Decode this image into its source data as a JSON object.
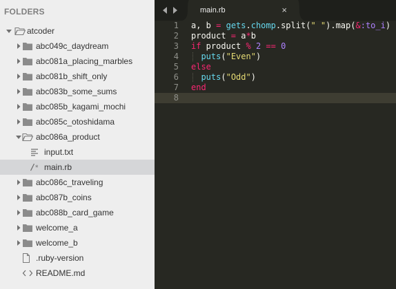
{
  "sidebar": {
    "header": "FOLDERS",
    "tree": [
      {
        "label": "atcoder",
        "type": "folder",
        "state": "open",
        "depth": 0,
        "name": "atcoder"
      },
      {
        "label": "abc049c_daydream",
        "type": "folder",
        "state": "closed",
        "depth": 1,
        "name": "abc049c-daydream"
      },
      {
        "label": "abc081a_placing_marbles",
        "type": "folder",
        "state": "closed",
        "depth": 1,
        "name": "abc081a-placing-marbles"
      },
      {
        "label": "abc081b_shift_only",
        "type": "folder",
        "state": "closed",
        "depth": 1,
        "name": "abc081b-shift-only"
      },
      {
        "label": "abc083b_some_sums",
        "type": "folder",
        "state": "closed",
        "depth": 1,
        "name": "abc083b-some-sums"
      },
      {
        "label": "abc085b_kagami_mochi",
        "type": "folder",
        "state": "closed",
        "depth": 1,
        "name": "abc085b-kagami-mochi"
      },
      {
        "label": "abc085c_otoshidama",
        "type": "folder",
        "state": "closed",
        "depth": 1,
        "name": "abc085c-otoshidama"
      },
      {
        "label": "abc086a_product",
        "type": "folder",
        "state": "open",
        "depth": 1,
        "name": "abc086a-product"
      },
      {
        "label": "input.txt",
        "type": "text-file",
        "depth": 2,
        "name": "input-txt"
      },
      {
        "label": "main.rb",
        "type": "code-file",
        "depth": 2,
        "selected": true,
        "name": "main-rb"
      },
      {
        "label": "abc086c_traveling",
        "type": "folder",
        "state": "closed",
        "depth": 1,
        "name": "abc086c-traveling"
      },
      {
        "label": "abc087b_coins",
        "type": "folder",
        "state": "closed",
        "depth": 1,
        "name": "abc087b-coins"
      },
      {
        "label": "abc088b_card_game",
        "type": "folder",
        "state": "closed",
        "depth": 1,
        "name": "abc088b-card-game"
      },
      {
        "label": "welcome_a",
        "type": "folder",
        "state": "closed",
        "depth": 1,
        "name": "welcome-a"
      },
      {
        "label": "welcome_b",
        "type": "folder",
        "state": "closed",
        "depth": 1,
        "name": "welcome-b"
      },
      {
        "label": ".ruby-version",
        "type": "file",
        "depth": 1,
        "name": "ruby-version"
      },
      {
        "label": "README.md",
        "type": "markup-file",
        "depth": 1,
        "name": "readme-md"
      }
    ]
  },
  "editor": {
    "nav": {
      "back_icon": "triangle-left-icon",
      "forward_icon": "triangle-right-icon"
    },
    "tab": {
      "title": "main.rb",
      "close": "×"
    },
    "current_line": 8,
    "lines": [
      {
        "no": "1",
        "tokens": [
          {
            "t": "a, b ",
            "c": "plain"
          },
          {
            "t": "=",
            "c": "op"
          },
          {
            "t": " ",
            "c": "plain"
          },
          {
            "t": "gets",
            "c": "func"
          },
          {
            "t": ".",
            "c": "plain"
          },
          {
            "t": "chomp",
            "c": "func"
          },
          {
            "t": ".split(",
            "c": "plain"
          },
          {
            "t": "\" \"",
            "c": "string"
          },
          {
            "t": ").map(",
            "c": "plain"
          },
          {
            "t": "&",
            "c": "op"
          },
          {
            "t": ":to_i",
            "c": "symbol"
          },
          {
            "t": ")",
            "c": "plain"
          }
        ]
      },
      {
        "no": "2",
        "tokens": [
          {
            "t": "product ",
            "c": "plain"
          },
          {
            "t": "=",
            "c": "op"
          },
          {
            "t": " a",
            "c": "plain"
          },
          {
            "t": "*",
            "c": "op"
          },
          {
            "t": "b",
            "c": "plain"
          }
        ]
      },
      {
        "no": "3",
        "tokens": [
          {
            "t": "if",
            "c": "keyword"
          },
          {
            "t": " product ",
            "c": "plain"
          },
          {
            "t": "%",
            "c": "op"
          },
          {
            "t": " ",
            "c": "plain"
          },
          {
            "t": "2",
            "c": "number"
          },
          {
            "t": " ",
            "c": "plain"
          },
          {
            "t": "==",
            "c": "op"
          },
          {
            "t": " ",
            "c": "plain"
          },
          {
            "t": "0",
            "c": "number"
          }
        ]
      },
      {
        "no": "4",
        "guide": true,
        "tokens": [
          {
            "t": "  ",
            "c": "plain"
          },
          {
            "t": "puts",
            "c": "func"
          },
          {
            "t": "(",
            "c": "plain"
          },
          {
            "t": "\"Even\"",
            "c": "string"
          },
          {
            "t": ")",
            "c": "plain"
          }
        ]
      },
      {
        "no": "5",
        "tokens": [
          {
            "t": "else",
            "c": "keyword"
          }
        ]
      },
      {
        "no": "6",
        "guide": true,
        "tokens": [
          {
            "t": "  ",
            "c": "plain"
          },
          {
            "t": "puts",
            "c": "func"
          },
          {
            "t": "(",
            "c": "plain"
          },
          {
            "t": "\"Odd\"",
            "c": "string"
          },
          {
            "t": ")",
            "c": "plain"
          }
        ]
      },
      {
        "no": "7",
        "tokens": [
          {
            "t": "end",
            "c": "keyword"
          }
        ]
      },
      {
        "no": "8",
        "tokens": []
      }
    ]
  },
  "colors": {
    "sidebar_bg": "#eeeeee",
    "sidebar_selected": "#d5d6d8",
    "editor_bg": "#272822",
    "current_line": "#3e3d32",
    "plain": "#f8f8f2",
    "keyword": "#f92672",
    "op": "#f92672",
    "func": "#66d9ef",
    "string": "#e6db74",
    "number": "#ae81ff",
    "symbol": "#ae81ff"
  }
}
